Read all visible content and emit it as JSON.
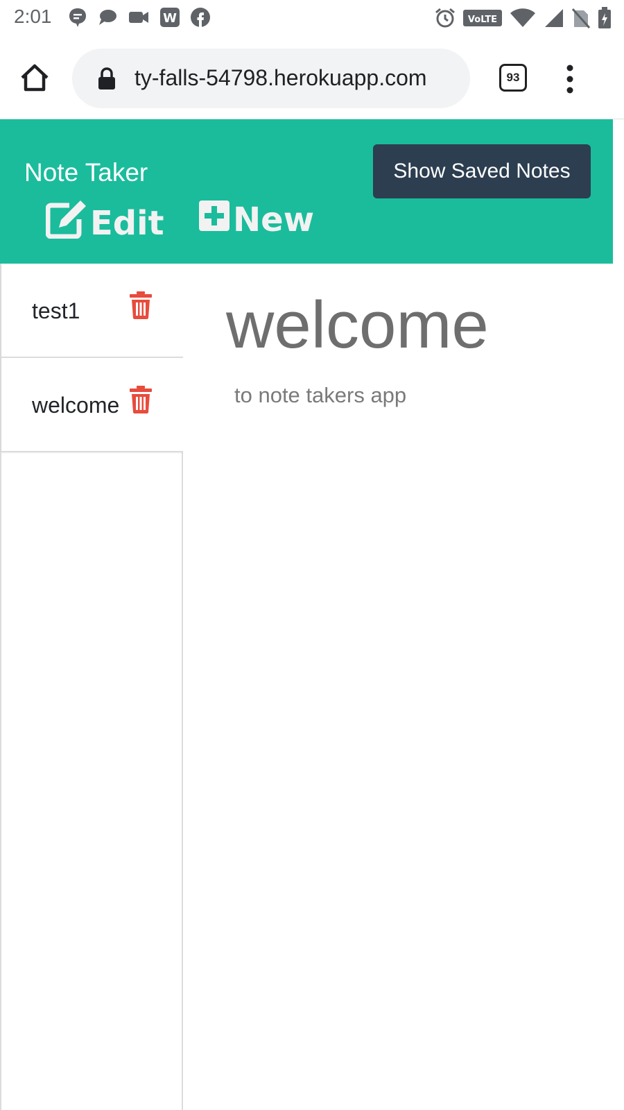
{
  "status_bar": {
    "time": "2:01",
    "notification_icons": [
      "chat-bubble-icon",
      "message-icon",
      "video-icon",
      "w-app-icon",
      "facebook-icon"
    ],
    "system_icons": [
      "alarm-icon",
      "volte-icon",
      "wifi-icon",
      "signal-icon",
      "no-sim-icon",
      "battery-icon"
    ],
    "volte_label": "VoLTE"
  },
  "browser": {
    "url": "ty-falls-54798.herokuapp.com",
    "tab_count": "93"
  },
  "header": {
    "title": "Note Taker",
    "saved_button": "Show Saved Notes",
    "edit_label": "Edit",
    "new_label": "New",
    "background_color": "#1abc9c",
    "button_color": "#2c3e50"
  },
  "notes": [
    {
      "title": "test1"
    },
    {
      "title": "welcome"
    }
  ],
  "active_note": {
    "title": "welcome",
    "text": "to note takers app"
  },
  "colors": {
    "delete_icon": "#e74c3c"
  }
}
